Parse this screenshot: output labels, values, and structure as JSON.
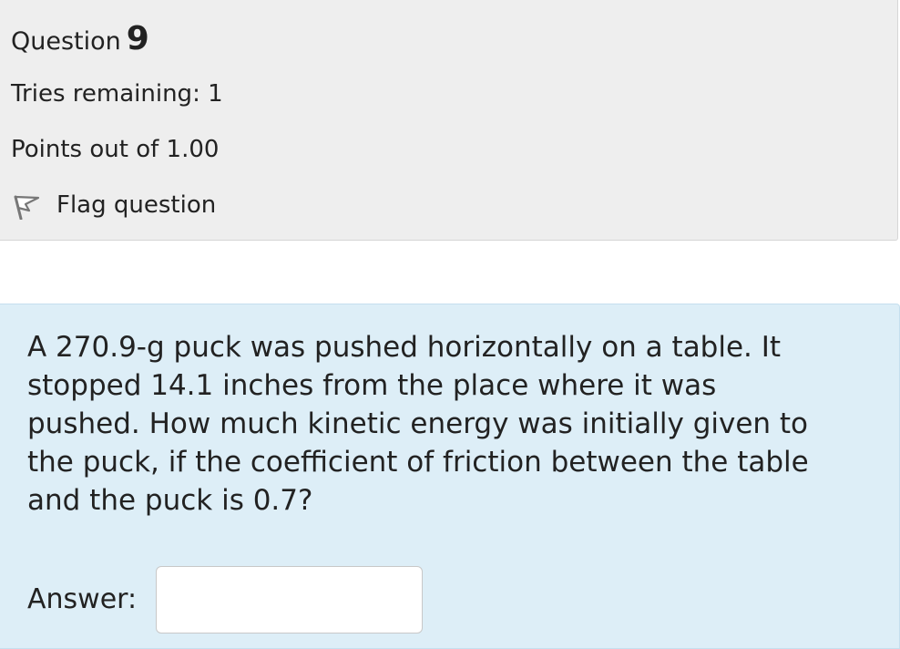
{
  "question_info": {
    "question_label": "Question",
    "question_number": "9",
    "tries_remaining": "Tries remaining: 1",
    "points": "Points out of 1.00",
    "flag_label": "Flag question"
  },
  "question": {
    "text": "A 270.9-g puck was pushed horizontally on a table. It stopped 14.1 inches from the place where it was pushed. How much kinetic energy was initially given to the puck, if the coefficient of friction between the table and the puck is 0.7?",
    "answer_label": "Answer:",
    "answer_value": "",
    "answer_placeholder": ""
  },
  "colors": {
    "info_panel_bg": "#eeeeee",
    "question_panel_bg": "#ddeef7",
    "text": "#222222",
    "flag_icon": "#777777"
  },
  "icons": {
    "flag": "flag-icon"
  }
}
